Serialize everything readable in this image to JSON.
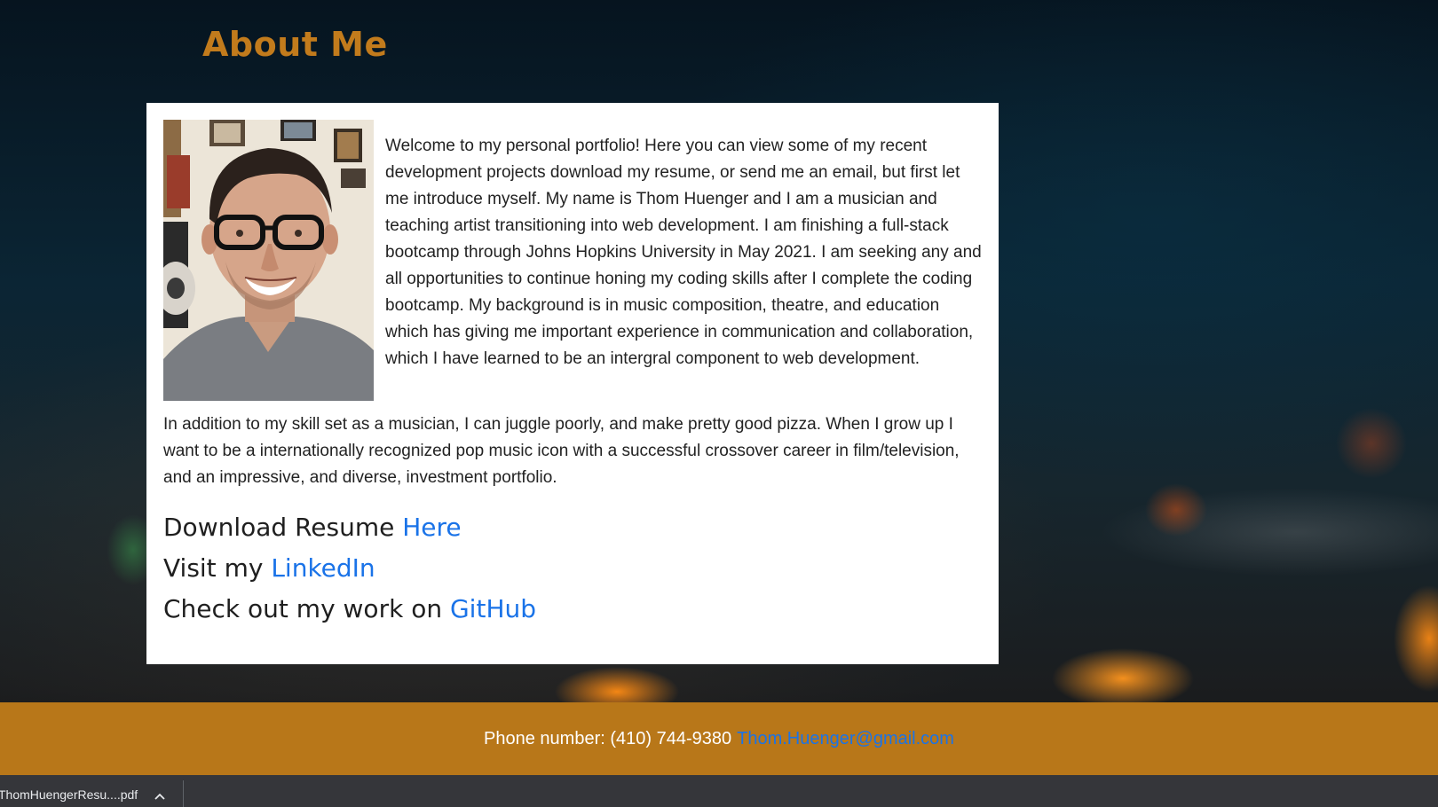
{
  "page": {
    "heading": "About Me"
  },
  "about": {
    "intro": "Welcome to my personal portfolio! Here you can view some of my recent development projects download my resume, or send me an email, but first let me introduce myself. My name is Thom Huenger and I am a musician and teaching artist transitioning into web development. I am finishing a full-stack bootcamp through Johns Hopkins University in May 2021. I am seeking any and all opportunities to continue honing my coding skills after I complete the coding bootcamp. My background is in music composition, theatre, and education which has giving me important experience in communication and collaboration, which I have learned to be an intergral component to web development.",
    "outro": "In addition to my skill set as a musician, I can juggle poorly, and make pretty good pizza. When I grow up I want to be a internationally recognized pop music icon with a successful crossover career in film/television, and an impressive, and diverse, investment portfolio.",
    "links": [
      {
        "prefix": "Download Resume ",
        "link_text": "Here"
      },
      {
        "prefix": "Visit my ",
        "link_text": "LinkedIn"
      },
      {
        "prefix": "Check out my work on ",
        "link_text": "GitHub"
      }
    ]
  },
  "footer": {
    "phone_text": "Phone number: (410) 744-9380",
    "email_text": "Thom.Huenger@gmail.com"
  },
  "download_bar": {
    "file_name": "ThomHuengerResu....pdf"
  },
  "colors": {
    "heading": "#c27b1c",
    "footer_bg": "#b87719",
    "link": "#1a73e8",
    "download_bar_bg": "#35363a"
  }
}
